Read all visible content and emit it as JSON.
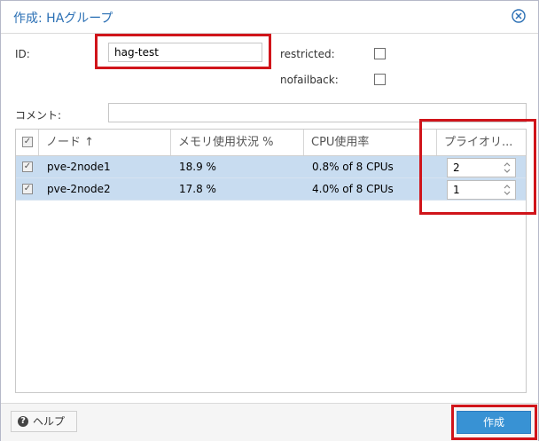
{
  "dialog": {
    "title": "作成: HAグループ",
    "close_icon": "close-circle-icon"
  },
  "form": {
    "id_label": "ID:",
    "id_value": "hag-test",
    "restricted_label": "restricted:",
    "restricted_checked": false,
    "nofailback_label": "nofailback:",
    "nofailback_checked": false,
    "comment_label": "コメント:",
    "comment_value": ""
  },
  "grid": {
    "columns": [
      "ノード ↑",
      "メモリ使用状況 %",
      "CPU使用率",
      "プライオリ..."
    ],
    "rows": [
      {
        "checked": true,
        "node": "pve-2node1",
        "memory": "18.9 %",
        "cpu": "0.8% of 8 CPUs",
        "priority": "2"
      },
      {
        "checked": true,
        "node": "pve-2node2",
        "memory": "17.8 %",
        "cpu": "4.0% of 8 CPUs",
        "priority": "1"
      }
    ]
  },
  "footer": {
    "help_label": "ヘルプ",
    "create_label": "作成"
  },
  "colors": {
    "accent": "#3892d4",
    "title": "#2a6fb4",
    "selected_row": "#c8dcf0",
    "highlight": "#d0141a"
  }
}
